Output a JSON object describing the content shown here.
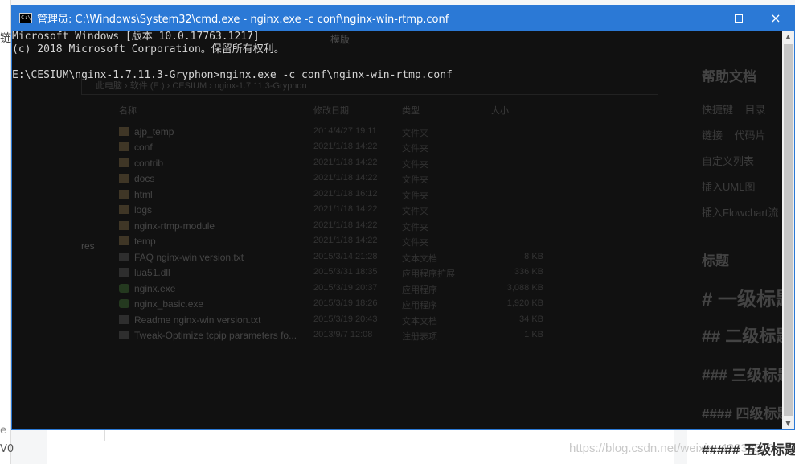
{
  "window": {
    "title": "管理员: C:\\Windows\\System32\\cmd.exe - nginx.exe  -c conf\\nginx-win-rtmp.conf",
    "icon": "cmd-icon",
    "icon_text": "C:\\",
    "controls": {
      "minimize": "minimize-icon",
      "maximize": "maximize-icon",
      "close": "×"
    },
    "accent_color": "#2b79d6"
  },
  "console": {
    "lines": [
      "Microsoft Windows [版本 10.0.17763.1217]",
      "(c) 2018 Microsoft Corporation。保留所有权利。",
      "",
      "E:\\CESIUM\\nginx-1.7.11.3-Gryphon>nginx.exe -c conf\\nginx-win-rtmp.conf"
    ]
  },
  "behind": {
    "ribbon": [
      "模版"
    ],
    "path": [
      "此电脑",
      "软件 (E:)",
      "CESIUM",
      "nginx-1.7.11.3-Gryphon"
    ],
    "columns": {
      "name": "名称",
      "date": "修改日期",
      "type": "类型",
      "size": "大小"
    },
    "files": [
      {
        "name": "ajp_temp",
        "date": "2014/4/27 19:11",
        "type": "文件夹",
        "size": "",
        "kind": "folder"
      },
      {
        "name": "conf",
        "date": "2021/1/18 14:22",
        "type": "文件夹",
        "size": "",
        "kind": "folder"
      },
      {
        "name": "contrib",
        "date": "2021/1/18 14:22",
        "type": "文件夹",
        "size": "",
        "kind": "folder"
      },
      {
        "name": "docs",
        "date": "2021/1/18 14:22",
        "type": "文件夹",
        "size": "",
        "kind": "folder"
      },
      {
        "name": "html",
        "date": "2021/1/18 16:12",
        "type": "文件夹",
        "size": "",
        "kind": "folder"
      },
      {
        "name": "logs",
        "date": "2021/1/18 14:22",
        "type": "文件夹",
        "size": "",
        "kind": "folder"
      },
      {
        "name": "nginx-rtmp-module",
        "date": "2021/1/18 14:22",
        "type": "文件夹",
        "size": "",
        "kind": "folder"
      },
      {
        "name": "temp",
        "date": "2021/1/18 14:22",
        "type": "文件夹",
        "size": "",
        "kind": "folder"
      },
      {
        "name": "FAQ nginx-win version.txt",
        "date": "2015/3/14 21:28",
        "type": "文本文档",
        "size": "8 KB",
        "kind": "doc"
      },
      {
        "name": "lua51.dll",
        "date": "2015/3/31 18:35",
        "type": "应用程序扩展",
        "size": "336 KB",
        "kind": "doc"
      },
      {
        "name": "nginx.exe",
        "date": "2015/3/19 20:37",
        "type": "应用程序",
        "size": "3,088 KB",
        "kind": "exe"
      },
      {
        "name": "nginx_basic.exe",
        "date": "2015/3/19 18:26",
        "type": "应用程序",
        "size": "1,920 KB",
        "kind": "exe"
      },
      {
        "name": "Readme nginx-win version.txt",
        "date": "2015/3/19 20:43",
        "type": "文本文档",
        "size": "34 KB",
        "kind": "doc"
      },
      {
        "name": "Tweak-Optimize tcpip parameters fo...",
        "date": "2013/9/7 12:08",
        "type": "注册表项",
        "size": "1 KB",
        "kind": "doc"
      }
    ],
    "sidebar_label": "res",
    "right_panel": {
      "title": "帮助文档",
      "items": [
        "快捷键",
        "目录",
        "链接",
        "代码片",
        "自定义列表",
        "插入UML图",
        "插入Flowchart流"
      ],
      "section": "标题",
      "headings": [
        "# 一级标题",
        "## 二级标题",
        "### 三级标题",
        "#### 四级标题",
        "##### 五级标题"
      ]
    },
    "watermark": "https://blog.csdn.net/weixin_42333510",
    "left_chars": [
      "链",
      "e",
      "V0"
    ]
  }
}
